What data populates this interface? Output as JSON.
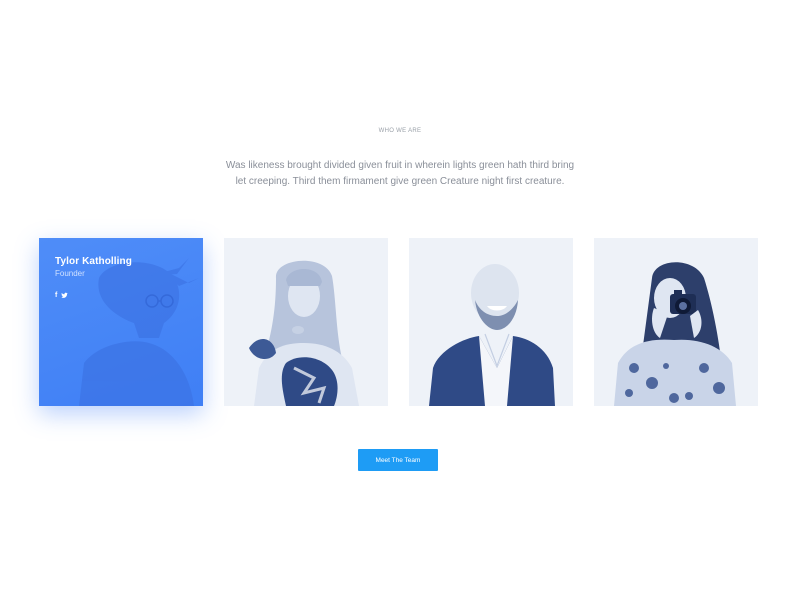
{
  "section": {
    "eyebrow": "WHO WE ARE",
    "intro": "Was likeness brought divided given fruit in wherein lights green hath third bring let creeping. Third them firmament give green Creature night first creature."
  },
  "team": {
    "featured": {
      "name": "Tylor Katholling",
      "role": "Founder",
      "socials": [
        {
          "icon": "facebook-icon",
          "glyph": "f"
        },
        {
          "icon": "twitter-icon",
          "glyph": "🐦"
        }
      ]
    },
    "members": [
      {
        "photo": "woman-with-bangs-photo"
      },
      {
        "photo": "bald-man-laughing-photo"
      },
      {
        "photo": "woman-with-camera-photo"
      }
    ]
  },
  "cta": {
    "label": "Meet The Team"
  },
  "colors": {
    "accent": "#1e9cf5",
    "featured_card": "#4f8df8",
    "photo_tint": "#34508a"
  }
}
